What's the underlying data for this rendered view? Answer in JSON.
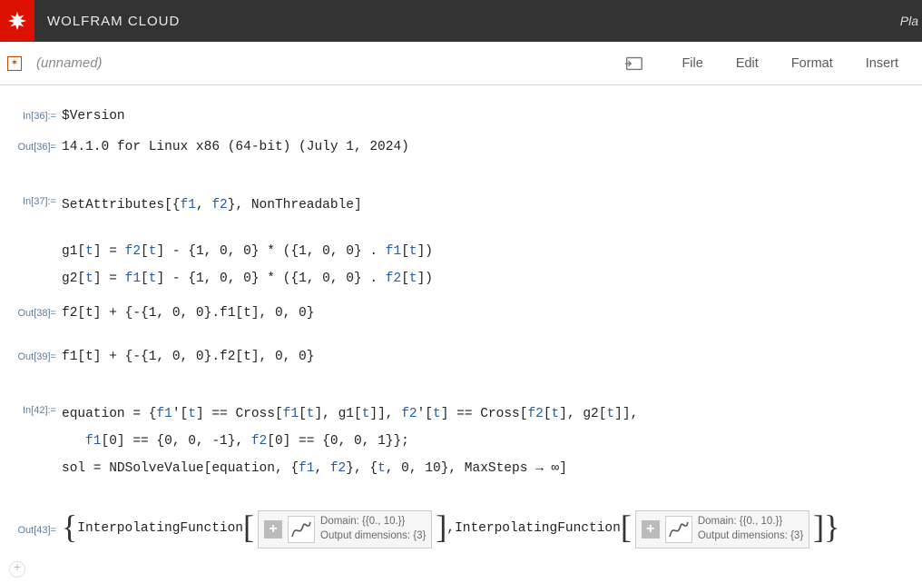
{
  "header": {
    "brand": "WOLFRAM CLOUD",
    "plan_partial": "Pla"
  },
  "toolbar": {
    "doc_title": "(unnamed)",
    "menus": [
      "File",
      "Edit",
      "Format",
      "Insert"
    ]
  },
  "cells": {
    "in36": {
      "label": "In[36]:=",
      "code": "$Version"
    },
    "out36": {
      "label": "Out[36]=",
      "text": "14.1.0 for Linux x86 (64-bit) (July 1, 2024)"
    },
    "in37": {
      "label": "In[37]:=",
      "line1_a": "SetAttributes[{",
      "line1_f1": "f1",
      "line1_mid": ", ",
      "line1_f2": "f2",
      "line1_b": "}, NonThreadable]",
      "line2_a": "g1[",
      "line2_t1": "t",
      "line2_b": "] = ",
      "line2_f2": "f2",
      "line2_c": "[",
      "line2_t2": "t",
      "line2_d": "] - {1, 0, 0} * ({1, 0, 0} . ",
      "line2_f1": "f1",
      "line2_e": "[",
      "line2_t3": "t",
      "line2_f": "])",
      "line3_a": "g2[",
      "line3_t1": "t",
      "line3_b": "] = ",
      "line3_f1": "f1",
      "line3_c": "[",
      "line3_t2": "t",
      "line3_d": "] - {1, 0, 0} * ({1, 0, 0} . ",
      "line3_f2": "f2",
      "line3_e": "[",
      "line3_t3": "t",
      "line3_f": "])"
    },
    "out38": {
      "label": "Out[38]=",
      "text": "f2[t] + {-{1, 0, 0}.f1[t], 0, 0}"
    },
    "out39": {
      "label": "Out[39]=",
      "text": "f1[t] + {-{1, 0, 0}.f2[t], 0, 0}"
    },
    "in42": {
      "label": "In[42]:=",
      "l1_a": "equation = {",
      "l1_f1a": "f1",
      "l1_b": "'[",
      "l1_t1": "t",
      "l1_c": "] == Cross[",
      "l1_f1b": "f1",
      "l1_d": "[",
      "l1_t2": "t",
      "l1_e": "], g1[",
      "l1_t3": "t",
      "l1_f": "]], ",
      "l1_f2a": "f2",
      "l1_g": "'[",
      "l1_t4": "t",
      "l1_h": "] == Cross[",
      "l1_f2b": "f2",
      "l1_i": "[",
      "l1_t5": "t",
      "l1_j": "], g2[",
      "l1_t6": "t",
      "l1_k": "]],",
      "l2_a": "   ",
      "l2_f1": "f1",
      "l2_b": "[0] == {0, 0, -1}, ",
      "l2_f2": "f2",
      "l2_c": "[0] == {0, 0, 1}};",
      "l3_a": "sol = NDSolveValue[equation, {",
      "l3_f1": "f1",
      "l3_b": ", ",
      "l3_f2": "f2",
      "l3_c": "}, {",
      "l3_t": "t",
      "l3_d": ", 0, 10}, MaxSteps → ∞]"
    },
    "out43": {
      "label": "Out[43]=",
      "fn_name": "InterpolatingFunction",
      "domain": "Domain: {{0., 10.}}",
      "outdim": "Output dimensions: {3}",
      "comma": ", "
    }
  }
}
